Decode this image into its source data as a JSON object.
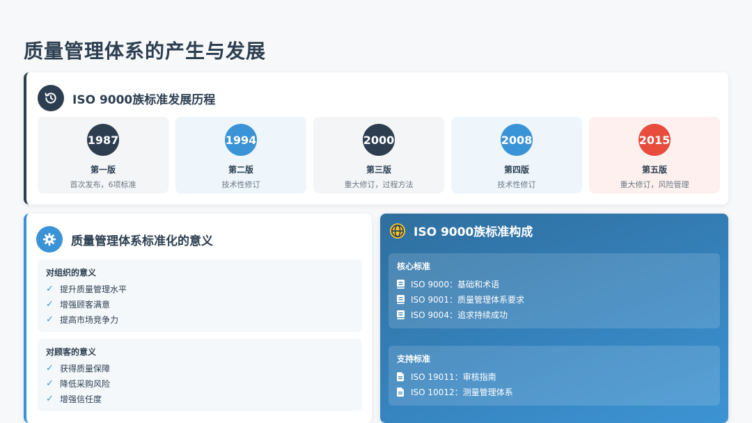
{
  "page": {
    "title": "质量管理体系的产生与发展"
  },
  "timeline": {
    "title": "ISO 9000族标准发展历程",
    "icon": "history-icon",
    "versions": [
      {
        "year": "1987",
        "name": "第一版",
        "desc": "首次发布，6项标准",
        "color": "#2c3e50"
      },
      {
        "year": "1994",
        "name": "第二版",
        "desc": "技术性修订",
        "color": "#3a93d6"
      },
      {
        "year": "2000",
        "name": "第三版",
        "desc": "重大修订，过程方法",
        "color": "#2c3e50"
      },
      {
        "year": "2008",
        "name": "第四版",
        "desc": "技术性修订",
        "color": "#3a93d6"
      },
      {
        "year": "2015",
        "name": "第五版",
        "desc": "重大修订，风险管理",
        "color": "#e74c3c"
      }
    ]
  },
  "significance": {
    "title": "质量管理体系标准化的意义",
    "icon": "gear-icon",
    "groups": [
      {
        "title": "对组织的意义",
        "items": [
          "提升质量管理水平",
          "增强顾客满意",
          "提高市场竞争力"
        ]
      },
      {
        "title": "对顾客的意义",
        "items": [
          "获得质量保障",
          "降低采购风险",
          "增强信任度"
        ]
      }
    ]
  },
  "structure": {
    "title": "ISO 9000族标准构成",
    "icon": "globe-icon",
    "core": {
      "title": "核心标准",
      "items": [
        "ISO 9000：基础和术语",
        "ISO 9001：质量管理体系要求",
        "ISO 9004：追求持续成功"
      ]
    },
    "support": {
      "title": "支持标准",
      "items": [
        "ISO 19011：审核指南",
        "ISO 10012：测量管理体系"
      ]
    }
  }
}
